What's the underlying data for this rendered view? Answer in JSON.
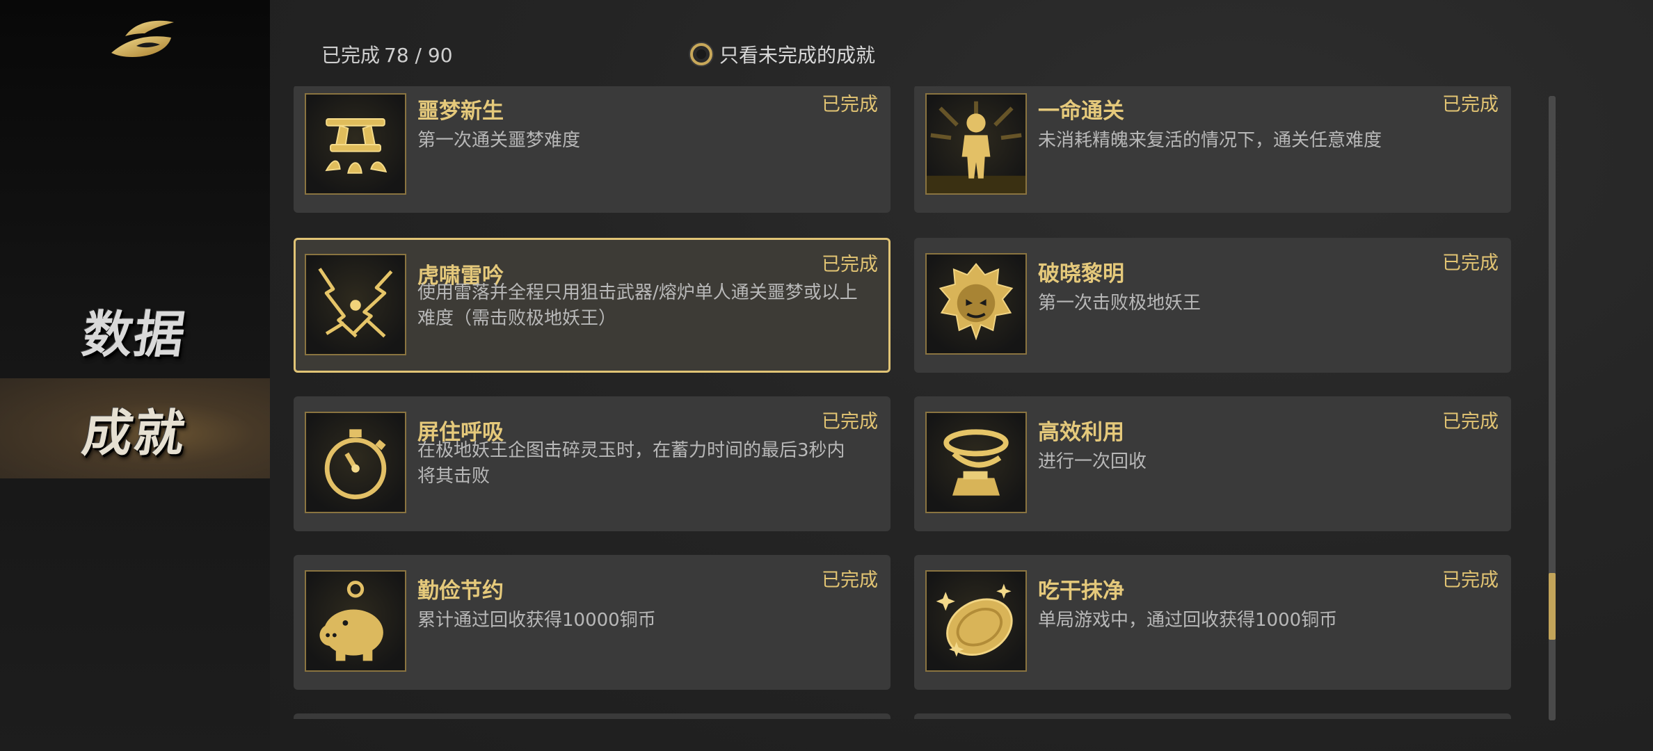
{
  "sidebar": {
    "items": [
      {
        "label": "数据",
        "active": false
      },
      {
        "label": "成就",
        "active": true
      }
    ]
  },
  "header": {
    "completed_label": "已完成",
    "completed_count": "78 / 90",
    "filter_label": "只看未完成的成就",
    "filter_checked": false
  },
  "achievements": [
    {
      "title": "噩梦新生",
      "desc": "第一次通关噩梦难度",
      "status": "已完成",
      "icon": "nightmare-glyph-icon"
    },
    {
      "title": "一命通关",
      "desc": "未消耗精魄来复活的情况下，通关任意难度",
      "status": "已完成",
      "icon": "figure-icon"
    },
    {
      "title": "虎啸雷吟",
      "desc": "使用雷落并全程只用狙击武器/熔炉单人通关噩梦或以上难度（需击败极地妖王）",
      "status": "已完成",
      "icon": "lightning-icon",
      "selected": true
    },
    {
      "title": "破晓黎明",
      "desc": "第一次击败极地妖王",
      "status": "已完成",
      "icon": "beast-emblem-icon"
    },
    {
      "title": "屏住呼吸",
      "desc": "在极地妖王企图击碎灵玉时，在蓄力时间的最后3秒内将其击败",
      "status": "已完成",
      "icon": "stopwatch-icon"
    },
    {
      "title": "高效利用",
      "desc": "进行一次回收",
      "status": "已完成",
      "icon": "recycle-box-icon"
    },
    {
      "title": "勤俭节约",
      "desc": "累计通过回收获得10000铜币",
      "status": "已完成",
      "icon": "piggy-bank-icon"
    },
    {
      "title": "吃干抹净",
      "desc": "单局游戏中，通过回收获得1000铜币",
      "status": "已完成",
      "icon": "coin-sparkle-icon"
    }
  ],
  "colors": {
    "gold": "#e2c473",
    "card_bg": "#3a3a3a",
    "selected_border": "#e1c476"
  }
}
